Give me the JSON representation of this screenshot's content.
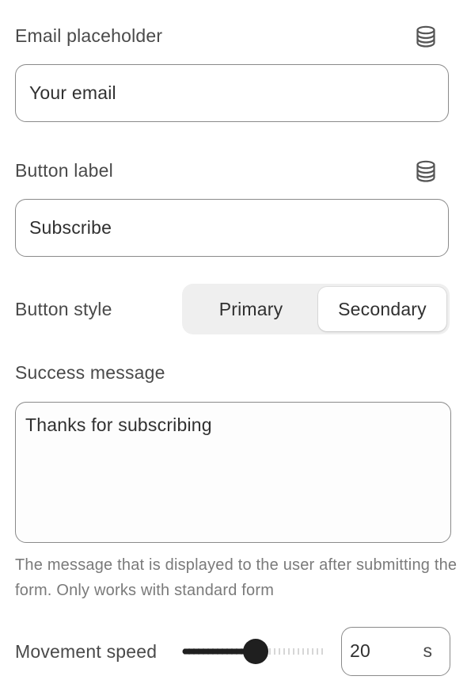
{
  "email_placeholder": {
    "label": "Email placeholder",
    "value": "Your email",
    "icon": "database-icon"
  },
  "button_label": {
    "label": "Button label",
    "value": "Subscribe",
    "icon": "database-icon"
  },
  "button_style": {
    "label": "Button style",
    "options": [
      "Primary",
      "Secondary"
    ],
    "selected": "Secondary"
  },
  "success_message": {
    "label": "Success message",
    "value": "Thanks for subscribing",
    "help": "The message that is displayed to the user after submitting the form. Only works with standard form"
  },
  "movement_speed": {
    "label": "Movement speed",
    "value": "20",
    "unit": "s",
    "slider_fraction": 0.5
  },
  "colors": {
    "text": "#303030",
    "label": "#4a4a4a",
    "help": "#7a7a7a",
    "border": "#8a8a8a",
    "segment_bg": "#efefef",
    "slider_fill": "#1f1f1f"
  }
}
